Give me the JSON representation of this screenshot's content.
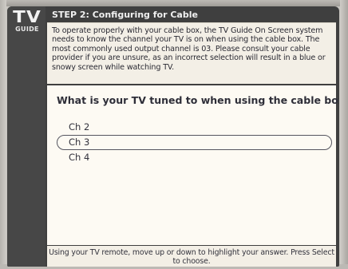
{
  "logo": {
    "line1": "TV",
    "line2": "GUIDE"
  },
  "header": {
    "title": "STEP 2: Configuring for Cable"
  },
  "info": {
    "text": "To operate properly with your cable box, the TV Guide On Screen system needs to know the channel your TV is on when using the cable box. The most commonly used output channel is 03. Please consult your cable provider if you are unsure, as an incorrect selection will result in a blue or snowy screen while watching TV."
  },
  "question": {
    "text": "What is your TV tuned to when using the cable box?"
  },
  "options": [
    {
      "label": "Ch 2",
      "selected": false
    },
    {
      "label": "Ch 3",
      "selected": true
    },
    {
      "label": "Ch 4",
      "selected": false
    }
  ],
  "footer": {
    "text": "Using your TV remote, move up or down to highlight your answer.  Press Select to choose."
  }
}
